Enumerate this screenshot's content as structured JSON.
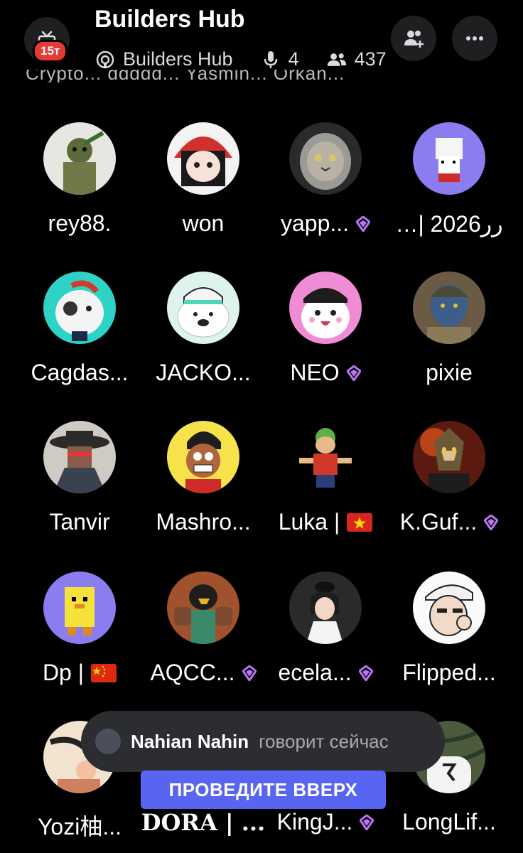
{
  "header": {
    "notif_badge": "15т",
    "title": "Builders Hub",
    "stage_name": "Builders Hub",
    "speakers": "4",
    "listeners": "437",
    "cut_text": "Crypto... ddddd... Yasmin... Orkan..."
  },
  "participants": [
    {
      "name": "rey88.",
      "boost": false
    },
    {
      "name": "won",
      "boost": false
    },
    {
      "name": "yapp...",
      "boost": true
    },
    {
      "name": "…| رر2026",
      "boost": false
    },
    {
      "name": "Cagdas...",
      "boost": false
    },
    {
      "name": "JACKO...",
      "boost": false
    },
    {
      "name": "NEO",
      "boost": true
    },
    {
      "name": "pixie",
      "boost": false
    },
    {
      "name": "Tanvir",
      "boost": false
    },
    {
      "name": "Mashro...",
      "boost": false
    },
    {
      "name": "Luka |",
      "boost": false,
      "flag": "vn"
    },
    {
      "name": "K.Guf...",
      "boost": true
    },
    {
      "name": "Dp |",
      "boost": false,
      "flag": "cn"
    },
    {
      "name": "AQCC...",
      "boost": true
    },
    {
      "name": "ecela...",
      "boost": true
    },
    {
      "name": "Flipped...",
      "boost": false
    },
    {
      "name": "Yozi柚...",
      "boost": false
    },
    {
      "name": "DORA | ...",
      "boost": false
    },
    {
      "name": "KingJ...",
      "boost": true
    },
    {
      "name": "LongLif...",
      "boost": false
    }
  ],
  "toast": {
    "speaker": "Nahian Nahin",
    "text": "говорит сейчас"
  },
  "swipe_label": "ПРОВЕДИТЕ ВВЕРХ",
  "colors": {
    "background": "#000000",
    "boost": "#b875f0",
    "blurple": "#5865f2",
    "badge": "#e53935"
  }
}
